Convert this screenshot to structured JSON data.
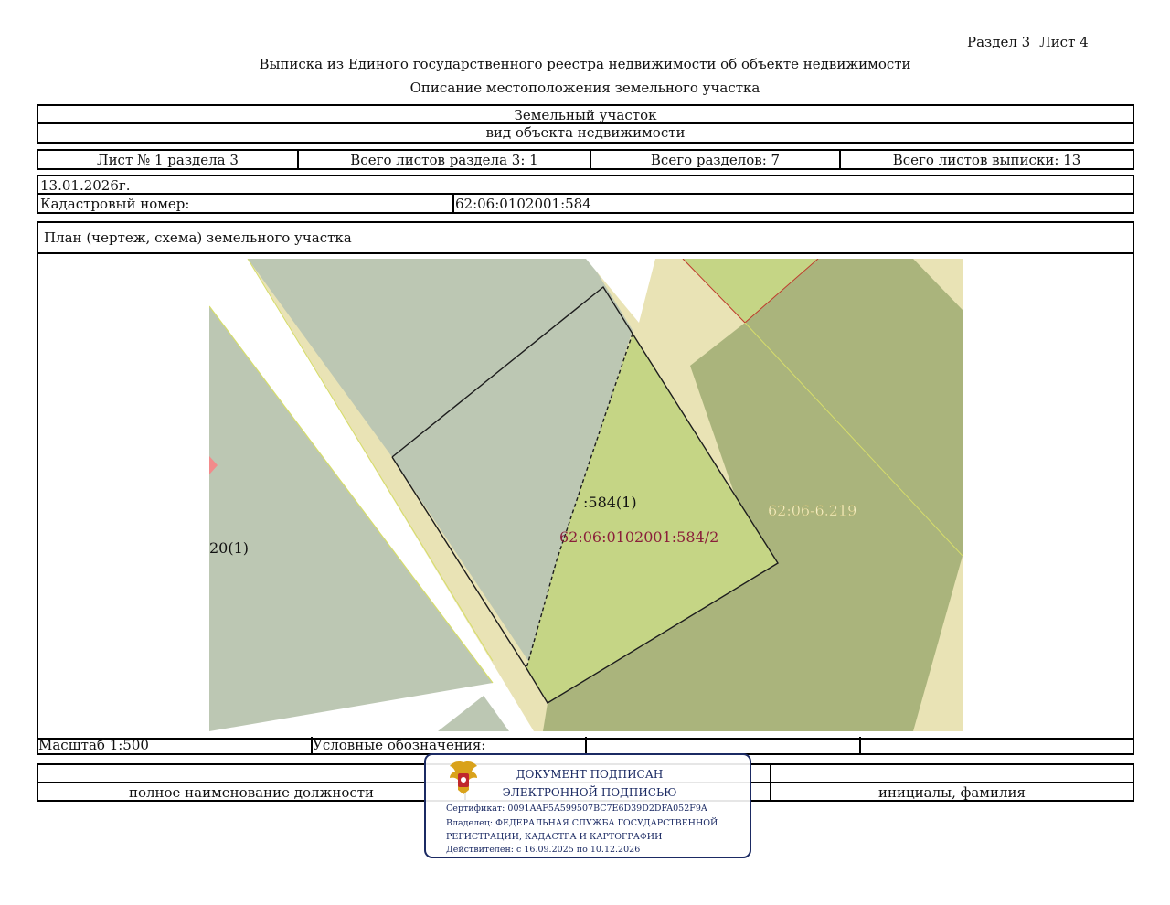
{
  "header": {
    "section": "Раздел 3",
    "sheet": "Лист 4",
    "title": "Выписка из Единого государственного реестра недвижимости об объекте недвижимости",
    "subtitle": "Описание местоположения земельного участка"
  },
  "object": {
    "type_value": "Земельный участок",
    "type_caption": "вид объекта недвижимости"
  },
  "sheets": {
    "sheet_no": "Лист № 1 раздела 3",
    "total_sheets_section": "Всего листов раздела 3: 1",
    "total_sections": "Всего разделов: 7",
    "total_sheets_extract": "Всего листов выписки: 13"
  },
  "meta": {
    "date": "13.01.2026г.",
    "cadastral_label": "Кадастровый номер:",
    "cadastral_value": "62:06:0102001:584"
  },
  "plan": {
    "heading": "План (чертеж, схема) земельного участка",
    "labels": {
      "left_parcel": "20(1)",
      "parcel_short": ":584(1)",
      "parcel_part": "62:06:0102001:584/2",
      "zone": "62:06-6.219"
    },
    "colors": {
      "grey_green": "#bcc7b3",
      "light_green": "#c5d585",
      "olive": "#aab47c",
      "beige": "#e9e3b5",
      "label_red": "#8a1f3a"
    }
  },
  "footer": {
    "scale": "Масштаб 1:500",
    "legend": "Условные обозначения:",
    "position_caption": "полное наименование должности",
    "name_caption": "инициалы, фамилия"
  },
  "stamp": {
    "line1": "ДОКУМЕНТ ПОДПИСАН",
    "line2": "ЭЛЕКТРОННОЙ ПОДПИСЬЮ",
    "certificate": "Сертификат: 0091AAF5A599507BC7E6D39D2DFA052F9A",
    "owner_line1": "Владелец: ФЕДЕРАЛЬНАЯ СЛУЖБА ГОСУДАРСТВЕННОЙ",
    "owner_line2": "РЕГИСТРАЦИИ, КАДАСТРА И КАРТОГРАФИИ",
    "valid": "Действителен: с 16.09.2025 по 10.12.2026",
    "emblem_icon": "coat-of-arms-icon"
  }
}
